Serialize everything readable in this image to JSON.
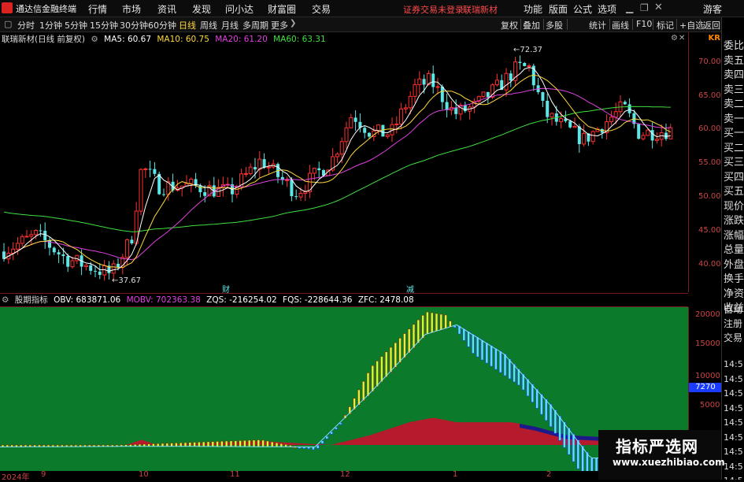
{
  "app": {
    "title": "通达信金融终端",
    "menus": [
      "行情",
      "市场",
      "资讯",
      "发现",
      "问小达",
      "财富圈",
      "交易"
    ],
    "notice_login": "证券交易未登录",
    "notice_stock": "联瑞新材",
    "right_menus": [
      "功能",
      "版面",
      "公式",
      "选项"
    ],
    "guest": "游客"
  },
  "toolbar": {
    "periods": [
      "分时",
      "1分钟",
      "5分钟",
      "15分钟",
      "30分钟",
      "60分钟",
      "日线",
      "周线",
      "月线",
      "多周期",
      "更多"
    ],
    "active_period": "日线",
    "tools": [
      "复权",
      "叠加",
      "多股",
      "统计",
      "画线",
      "F10",
      "标记",
      "+自选",
      "返回"
    ]
  },
  "main": {
    "stock_label": "联瑞新材(日线 前复权)",
    "ma": [
      {
        "label": "MA5: 60.67",
        "color": "#ffffff"
      },
      {
        "label": "MA10: 60.75",
        "color": "#ffd83a"
      },
      {
        "label": "MA20: 61.20",
        "color": "#e040e0"
      },
      {
        "label": "MA60: 63.31",
        "color": "#40e040"
      }
    ],
    "high_label": "72.37",
    "low_label": "37.67",
    "marker_cai": "财",
    "marker_jian": "减",
    "price_ticks": [
      "70.00",
      "65.00",
      "60.00",
      "55.00",
      "50.00",
      "45.00",
      "40.00"
    ],
    "corner_label": "KR"
  },
  "indicator": {
    "name": "股期指标",
    "values": [
      {
        "label": "OBV: 683871.06",
        "color": "#ffffff"
      },
      {
        "label": "MOBV: 702363.38",
        "color": "#e040e0"
      },
      {
        "label": "ZQS: -216254.02",
        "color": "#ffffff"
      },
      {
        "label": "FQS: -228644.36",
        "color": "#ffffff"
      },
      {
        "label": "ZFC: 2478.08",
        "color": "#ffffff"
      }
    ],
    "axis_ticks": [
      "20000",
      "15000",
      "10000",
      "5000"
    ],
    "axis_highlight": "7270"
  },
  "time_axis": [
    "2024年",
    "9",
    "10",
    "11",
    "12",
    "1",
    "2"
  ],
  "right_panel": {
    "items": [
      "委比",
      "卖五",
      "卖四",
      "卖三",
      "卖二",
      "卖一",
      "买一",
      "买二",
      "买三",
      "买四",
      "买五",
      "现价",
      "涨跌",
      "涨幅",
      "总量",
      "外盘",
      "换手",
      "净资",
      "收益"
    ],
    "lower_items": [
      "自动",
      "注册",
      "交易"
    ],
    "times": [
      "14:5",
      "14:5",
      "14:5",
      "14:5",
      "14:5",
      "14:5",
      "14:5",
      "14:5",
      "14:5"
    ]
  },
  "watermark": {
    "line1": "指标严选网",
    "line2": "www.xuezhibiao.com"
  },
  "colors": {
    "up": "#ff3030",
    "down": "#5ee6e6",
    "ma5": "#ffffff",
    "ma10": "#ffd83a",
    "ma20": "#e040e0",
    "ma60": "#40e040",
    "indicator_bg": "#0b7a2a"
  }
}
